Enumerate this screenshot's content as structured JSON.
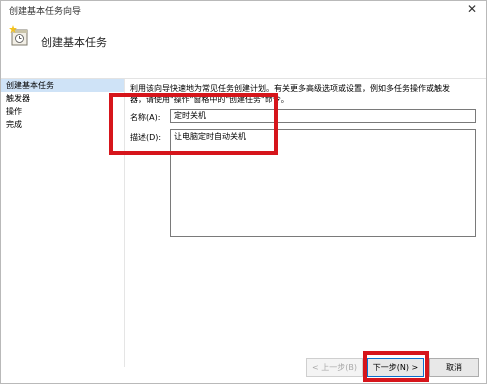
{
  "window": {
    "title": "创建基本任务向导",
    "close_glyph": "✕"
  },
  "header": {
    "title": "创建基本任务",
    "icon": "task-wizard-icon"
  },
  "sidebar": {
    "items": [
      {
        "label": "创建基本任务",
        "active": true
      },
      {
        "label": "触发器",
        "active": false
      },
      {
        "label": "操作",
        "active": false
      },
      {
        "label": "完成",
        "active": false
      }
    ]
  },
  "main": {
    "intro_line1": "利用该向导快速地为常见任务创建计划。有关更多高级选项或设置，例如多任务操作或触发",
    "intro_line2": "器，请使用\"操作\"窗格中的\"创建任务\"命令。",
    "name_label": "名称(A):",
    "name_value": "定时关机",
    "description_label": "描述(D):",
    "description_value": "让电脑定时自动关机"
  },
  "footer": {
    "back_label": "< 上一步(B)",
    "next_label": "下一步(N) >",
    "cancel_label": "取消"
  },
  "colors": {
    "highlight": "#d6151b",
    "sidebar_active": "#cfe3f7",
    "default_button_border": "#0b6fcd"
  }
}
